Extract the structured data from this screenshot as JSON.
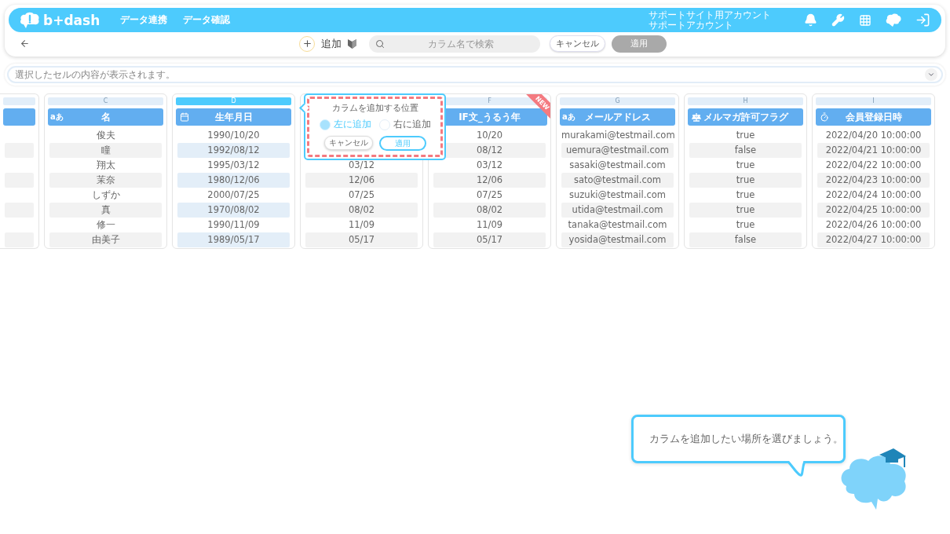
{
  "nav": {
    "logo": "b+dash",
    "menu": [
      "データ連携",
      "データ確認"
    ],
    "account_site": "サポートサイト用アカウント",
    "account_name": "サポートアカウント"
  },
  "toolbar": {
    "add_label": "追加",
    "search_placeholder": "カラム名で検索",
    "cancel": "キャンセル",
    "apply": {
      "label": "適用",
      "disabled": true
    }
  },
  "cell_info": {
    "placeholder": "選択したセルの内容が表示されます。"
  },
  "columns": [
    {
      "kind": "clipped",
      "selected": false,
      "cells": [
        "",
        "",
        "",
        "",
        "",
        "",
        "",
        ""
      ]
    },
    {
      "kind": "text",
      "letter": "C",
      "header": "名",
      "type_label": "aあ",
      "selected": false,
      "cells": [
        "俊夫",
        "瞳",
        "翔太",
        "茉奈",
        "しずか",
        "真",
        "修一",
        "由美子"
      ]
    },
    {
      "kind": "date",
      "letter": "D",
      "header": "生年月日",
      "selected": true,
      "cells": [
        "1990/10/20",
        "1992/08/12",
        "1995/03/12",
        "1980/12/06",
        "2000/07/25",
        "1970/08/02",
        "1990/11/09",
        "1989/05/17"
      ]
    },
    {
      "kind": "covered",
      "selected": false,
      "cells": [
        "03/12",
        "12/06",
        "07/25",
        "08/02",
        "11/09",
        "05/17"
      ]
    },
    {
      "kind": "text",
      "letter": "F",
      "header": "IF文_うるう年",
      "badge": "NEW",
      "selected": false,
      "cells": [
        "10/20",
        "08/12",
        "03/12",
        "12/06",
        "07/25",
        "08/02",
        "11/09",
        "05/17"
      ]
    },
    {
      "kind": "text",
      "letter": "G",
      "header": "メールアドレス",
      "type_label": "aあ",
      "selected": false,
      "cells": [
        "murakami@testmail.com",
        "uemura@testmail.com",
        "sasaki@testmail.com",
        "sato@testmail.com",
        "suzuki@testmail.com",
        "utida@testmail.com",
        "tanaka@testmail.com",
        "yosida@testmail.com"
      ]
    },
    {
      "kind": "flag",
      "letter": "H",
      "header": "メルマガ許可フラグ",
      "selected": false,
      "cells": [
        "true",
        "false",
        "true",
        "true",
        "true",
        "true",
        "true",
        "false"
      ]
    },
    {
      "kind": "datetime",
      "letter": "I",
      "header": "会員登録日時",
      "selected": false,
      "cells": [
        "2022/04/20 10:00:00",
        "2022/04/21 10:00:00",
        "2022/04/22 10:00:00",
        "2022/04/23 10:00:00",
        "2022/04/24 10:00:00",
        "2022/04/25 10:00:00",
        "2022/04/26 10:00:00",
        "2022/04/27 10:00:00"
      ]
    }
  ],
  "popup": {
    "title": "カラムを追加する位置",
    "options": [
      {
        "label": "左に追加",
        "selected": true
      },
      {
        "label": "右に追加",
        "selected": false
      }
    ],
    "cancel": "キャンセル",
    "apply": "適用"
  },
  "guide": {
    "text": "カラムを追加したい場所を選びましょう。"
  }
}
